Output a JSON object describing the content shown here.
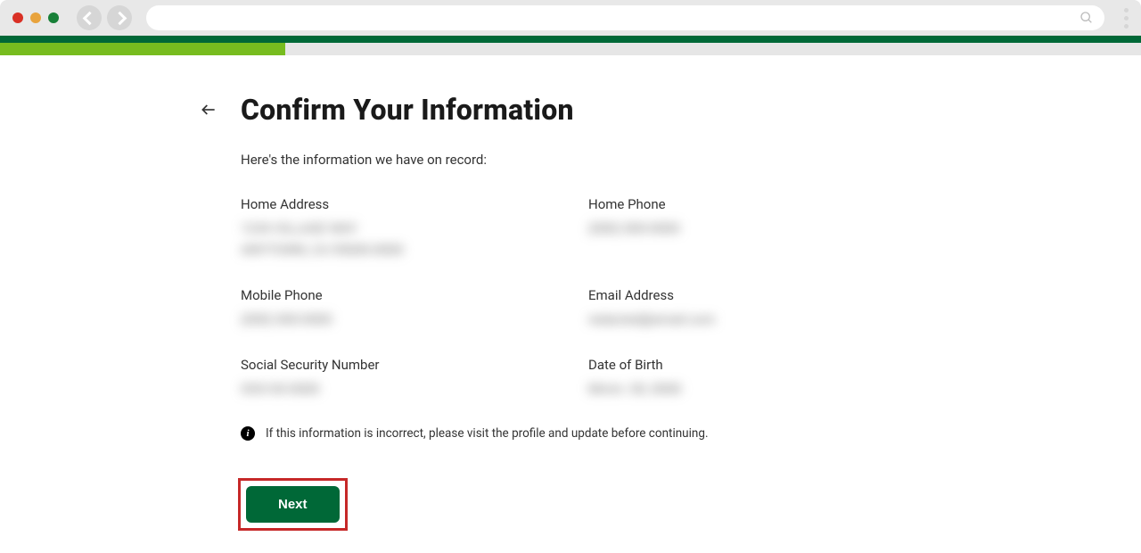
{
  "browser": {
    "url": ""
  },
  "brand": {
    "primary": "#006837",
    "accent": "#77bc1f"
  },
  "header": {
    "title": "Confirm Your Information",
    "subtitle": "Here's the information we have on record:"
  },
  "fields": {
    "home_address": {
      "label": "Home Address",
      "value_line1": "1234 VILLAGE WAY",
      "value_line2": "ANYTOWN, CA 95000-0000"
    },
    "home_phone": {
      "label": "Home Phone",
      "value": "(000) 000-0000"
    },
    "mobile_phone": {
      "label": "Mobile Phone",
      "value": "(000) 000-0000"
    },
    "email": {
      "label": "Email Address",
      "value": "redacted@email.com"
    },
    "ssn": {
      "label": "Social Security Number",
      "value": "XXX-XX-0000"
    },
    "dob": {
      "label": "Date of Birth",
      "value": "Mmm. 00, 0000"
    }
  },
  "info_note": "If this information is incorrect, please visit the profile and update before continuing.",
  "actions": {
    "next_label": "Next"
  }
}
